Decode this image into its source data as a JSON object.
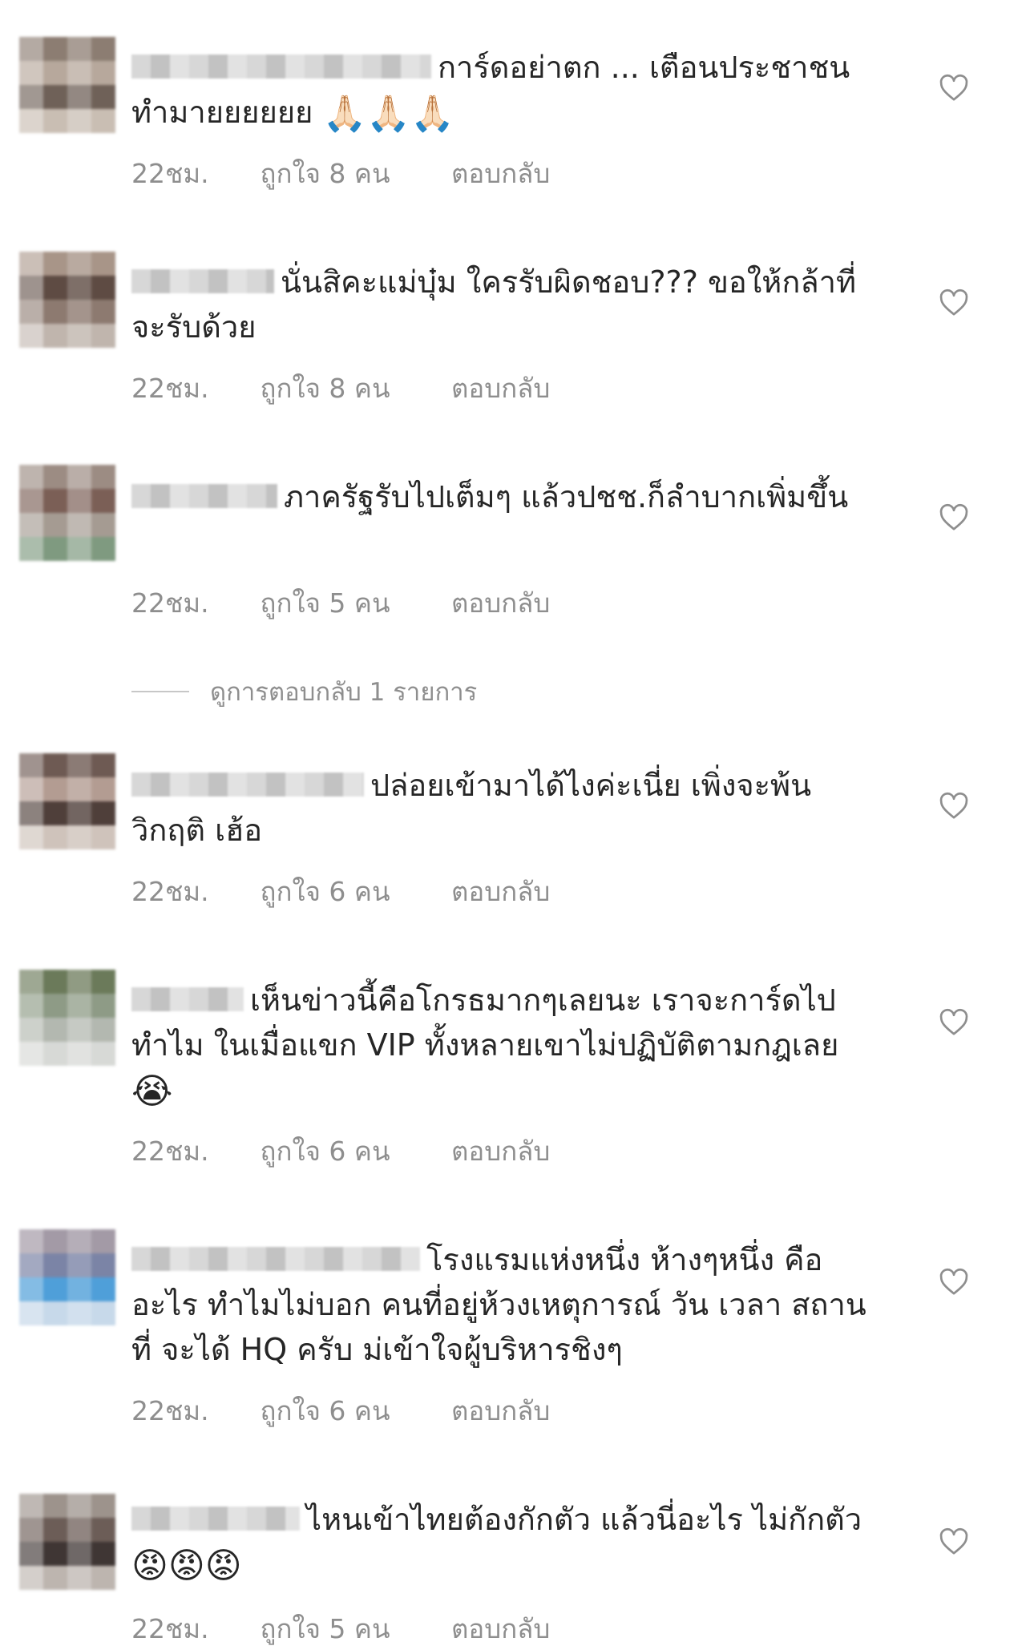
{
  "comments": [
    {
      "text": "การ์ดอย่าตก ... เตือนประชาชนทำมายยยยยย",
      "emoji": "🙏🏻🙏🏻🙏🏻",
      "time": "22ชม.",
      "likes": "ถูกใจ 8 คน",
      "reply": "ตอบกลับ"
    },
    {
      "text": "นั่นสิคะแม่บุ๋ม ใครรับผิดชอบ??? ขอให้กล้าที่จะรับด้วย",
      "emoji": "",
      "time": "22ชม.",
      "likes": "ถูกใจ 8 คน",
      "reply": "ตอบกลับ"
    },
    {
      "text": "ภาครัฐรับไปเต็มๆ แล้วปชช.ก็ลำบากเพิ่มขึ้น",
      "emoji": "",
      "time": "22ชม.",
      "likes": "ถูกใจ 5 คน",
      "reply": "ตอบกลับ"
    },
    {
      "text": "ปล่อยเข้ามาได้ไงค่ะเนี่ย เพิ่งจะพ้นวิกฤติ เฮ้อ",
      "emoji": "",
      "time": "22ชม.",
      "likes": "ถูกใจ 6 คน",
      "reply": "ตอบกลับ"
    },
    {
      "text": "เห็นข่าวนี้คือโกรธมากๆเลยนะ เราจะการ์ดไปทำไม ในเมื่อแขก VIP ทั้งหลายเขาไม่ปฏิบัติตามกฎเลย",
      "emoji": "😭",
      "time": "22ชม.",
      "likes": "ถูกใจ 6 คน",
      "reply": "ตอบกลับ"
    },
    {
      "text": "โรงแรมแห่งหนึ่ง ห้างๆหนึ่ง คืออะไร ทำไมไม่บอก คนที่อยู่ห้วงเหตุการณ์ วัน เวลา สถานที่ จะได้ HQ ครับ ม่เข้าใจผู้บริหารชิงๆ",
      "emoji": "",
      "time": "22ชม.",
      "likes": "ถูกใจ 6 คน",
      "reply": "ตอบกลับ"
    },
    {
      "text": "ไหนเข้าไทยต้องกักตัว แล้วนี่อะไร ไม่กักตัว",
      "emoji": "😡😡😡",
      "time": "22ชม.",
      "likes": "ถูกใจ 5 คน",
      "reply": "ตอบกลับ"
    }
  ],
  "view_replies": "ดูการตอบกลับ 1 รายการ",
  "icons": {
    "like": "heart-outline-icon"
  },
  "colors": {
    "text": "#262626",
    "meta": "#8e8e8e",
    "background": "#ffffff"
  }
}
